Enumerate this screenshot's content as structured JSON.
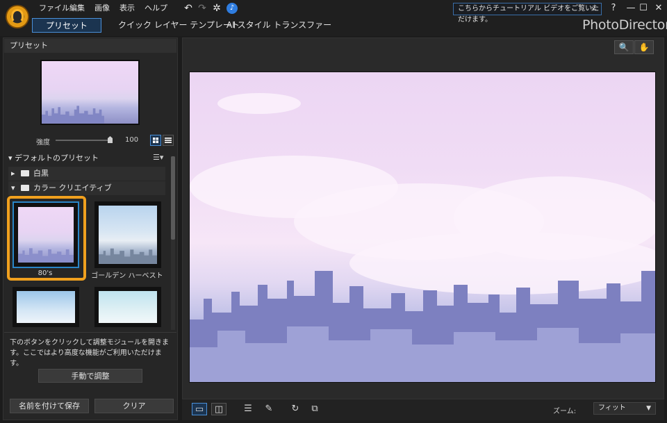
{
  "menu": [
    "ファイル",
    "編集",
    "画像",
    "表示",
    "ヘルプ"
  ],
  "toolbar": {
    "undo_icon": "undo-icon",
    "redo_icon": "redo-icon",
    "settings_icon": "gear-icon",
    "notify_icon": "bell-icon"
  },
  "tutorial": {
    "text": "こちらからチュートリアル ビデオをご覧いただけます。",
    "close": "×"
  },
  "window": {
    "help": "?",
    "minimize": "—",
    "maximize": "☐",
    "close": "✕"
  },
  "tabs": [
    "プリセット",
    "クイック レイヤー テンプレート",
    "AI スタイル トランスファー"
  ],
  "brand": "PhotoDirector",
  "panel": {
    "title": "プリセット",
    "intensity_label": "強度",
    "intensity_value": "100",
    "intensity_fraction": 1.0,
    "default_presets": "デフォルトのプリセット",
    "folders": [
      "白黒",
      "カラー クリエイティブ"
    ],
    "presets": [
      "80's",
      "ゴールデン ハーベスト"
    ],
    "info_text": "下のボタンをクリックして調整モジュールを開きます。ここではより高度な機能がご利用いただけます。",
    "manual_button": "手動で調整",
    "save_as_button": "名前を付けて保存",
    "clear_button": "クリア"
  },
  "view": {
    "zoom_label": "ズーム:",
    "zoom_value": "フィット"
  },
  "colors": {
    "accent": "#4a90d9",
    "highlight": "#f0a01e",
    "selection": "#2a86c8"
  }
}
